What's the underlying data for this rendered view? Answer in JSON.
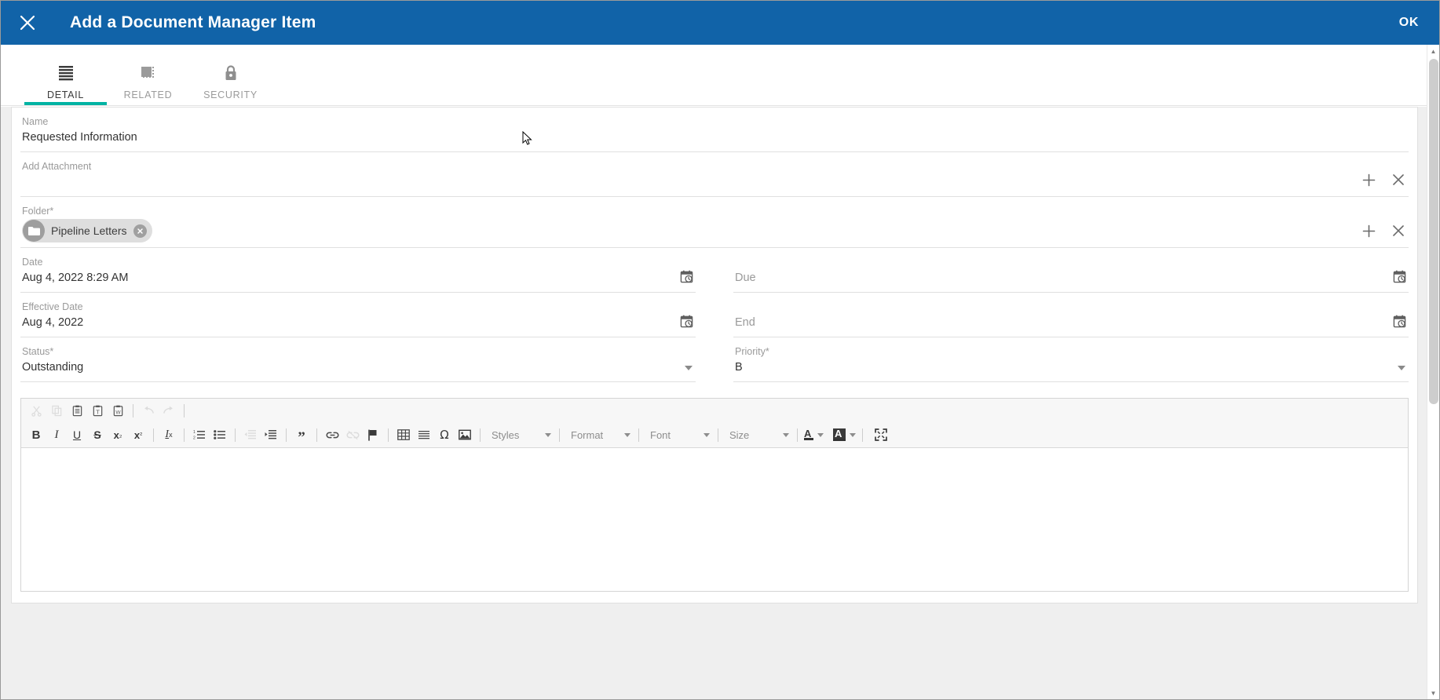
{
  "window": {
    "title": "Add a Document Manager Item",
    "close_icon": "close-icon",
    "ok_label": "OK",
    "header_color": "#1163a8",
    "accent_color": "#00b3a3"
  },
  "tabs": [
    {
      "label": "DETAIL",
      "icon": "list-lines-icon",
      "active": true
    },
    {
      "label": "RELATED",
      "icon": "related-squares-icon",
      "active": false
    },
    {
      "label": "SECURITY",
      "icon": "lock-icon",
      "active": false
    }
  ],
  "form": {
    "name": {
      "label": "Name",
      "value": "Requested Information"
    },
    "add_attachment": {
      "label": "Add Attachment",
      "value": "",
      "add_icon": "plus-icon",
      "clear_icon": "close-icon"
    },
    "folder": {
      "label": "Folder*",
      "chip": {
        "text": "Pipeline Letters",
        "avatar_icon": "folder-icon",
        "remove_icon": "chip-remove-icon"
      },
      "add_icon": "plus-icon",
      "clear_icon": "close-icon"
    },
    "date": {
      "label": "Date",
      "value": "Aug 4, 2022 8:29 AM",
      "picker_icon": "calendar-clock-icon"
    },
    "due": {
      "label": "Due",
      "placeholder": "Due",
      "value": "",
      "picker_icon": "calendar-clock-icon"
    },
    "effective_date": {
      "label": "Effective Date",
      "value": "Aug 4, 2022",
      "picker_icon": "calendar-clock-icon"
    },
    "end": {
      "label": "End",
      "placeholder": "End",
      "value": "",
      "picker_icon": "calendar-clock-icon"
    },
    "status": {
      "label": "Status*",
      "value": "Outstanding",
      "caret_icon": "chevron-down-icon"
    },
    "priority": {
      "label": "Priority*",
      "value": "B",
      "caret_icon": "chevron-down-icon"
    }
  },
  "editor": {
    "toolbar_row1": [
      {
        "name": "cut-icon",
        "glyph": "✂",
        "disabled": true
      },
      {
        "name": "copy-icon",
        "glyph": "❐",
        "disabled": true
      },
      {
        "name": "paste-icon",
        "glyph": "ὌB",
        "disabled": false
      },
      {
        "name": "paste-as-plain-text-icon",
        "glyph": "T",
        "disabled": false
      },
      {
        "name": "paste-from-word-icon",
        "glyph": "W",
        "disabled": false
      },
      {
        "name": "undo-icon",
        "glyph": "↶",
        "disabled": true
      },
      {
        "name": "redo-icon",
        "glyph": "↷",
        "disabled": true
      }
    ],
    "toolbar_row2": [
      {
        "name": "bold-icon",
        "glyph": "B",
        "disabled": false
      },
      {
        "name": "italic-icon",
        "glyph": "I",
        "disabled": false
      },
      {
        "name": "underline-icon",
        "glyph": "U",
        "disabled": false
      },
      {
        "name": "strikethrough-icon",
        "glyph": "S",
        "disabled": false
      },
      {
        "name": "subscript-icon",
        "glyph": "x₂",
        "disabled": false
      },
      {
        "name": "superscript-icon",
        "glyph": "x²",
        "disabled": false
      },
      {
        "name": "remove-format-icon",
        "glyph": "Tx",
        "disabled": false
      },
      {
        "name": "numbered-list-icon",
        "glyph": "list",
        "disabled": false
      },
      {
        "name": "bulleted-list-icon",
        "glyph": "list",
        "disabled": false
      },
      {
        "name": "decrease-indent-icon",
        "glyph": "indent",
        "disabled": true
      },
      {
        "name": "increase-indent-icon",
        "glyph": "indent",
        "disabled": false
      },
      {
        "name": "blockquote-icon",
        "glyph": "”",
        "disabled": false
      },
      {
        "name": "link-icon",
        "glyph": "link",
        "disabled": false
      },
      {
        "name": "unlink-icon",
        "glyph": "unlink",
        "disabled": true
      },
      {
        "name": "anchor-flag-icon",
        "glyph": "flag",
        "disabled": false
      },
      {
        "name": "table-icon",
        "glyph": "table",
        "disabled": false
      },
      {
        "name": "horizontal-rule-icon",
        "glyph": "hr",
        "disabled": false
      },
      {
        "name": "special-character-icon",
        "glyph": "Ω",
        "disabled": false
      },
      {
        "name": "image-icon",
        "glyph": "image",
        "disabled": false
      }
    ],
    "combos": [
      {
        "name": "styles-combo",
        "label": "Styles"
      },
      {
        "name": "format-combo",
        "label": "Format"
      },
      {
        "name": "font-combo",
        "label": "Font"
      },
      {
        "name": "size-combo",
        "label": "Size"
      }
    ],
    "color_buttons": [
      {
        "name": "text-color-button",
        "glyph": "A"
      },
      {
        "name": "background-color-button",
        "glyph": "A"
      }
    ],
    "maximize": {
      "name": "maximize-icon",
      "glyph": "maximize"
    },
    "content": ""
  },
  "scrollbar": {
    "up_arrow": "▲",
    "down_arrow": "▼"
  }
}
